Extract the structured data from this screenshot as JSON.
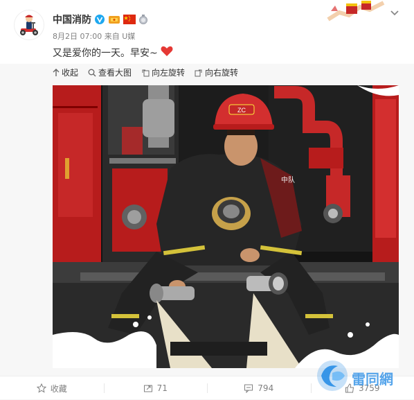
{
  "header": {
    "username": "中国消防",
    "meta_time": "8月2日 07:00",
    "meta_source": "来自 U媒",
    "content_text": "又是爱你的一天。早安~"
  },
  "toolbar": {
    "collapse_label": "收起",
    "view_large_label": "查看大图",
    "rotate_left_label": "向左旋转",
    "rotate_right_label": "向右旋转"
  },
  "photo": {
    "helmet_text": "ZC",
    "chest_text": "中队"
  },
  "footer": {
    "favorite_label": "收藏",
    "repost_count": "71",
    "comment_count": "794",
    "like_count": "3759"
  },
  "watermark": {
    "text": "雷同網"
  },
  "colors": {
    "accent": "#eb7350",
    "heart": "#e53935",
    "verified": "#1ea8f0",
    "watermark": "#1e88e5"
  },
  "icons": {
    "verified": "verified-v-icon",
    "heart": "heart-icon",
    "star": "star-icon",
    "repost": "repost-icon",
    "comment": "comment-icon",
    "like": "thumbs-up-icon"
  }
}
